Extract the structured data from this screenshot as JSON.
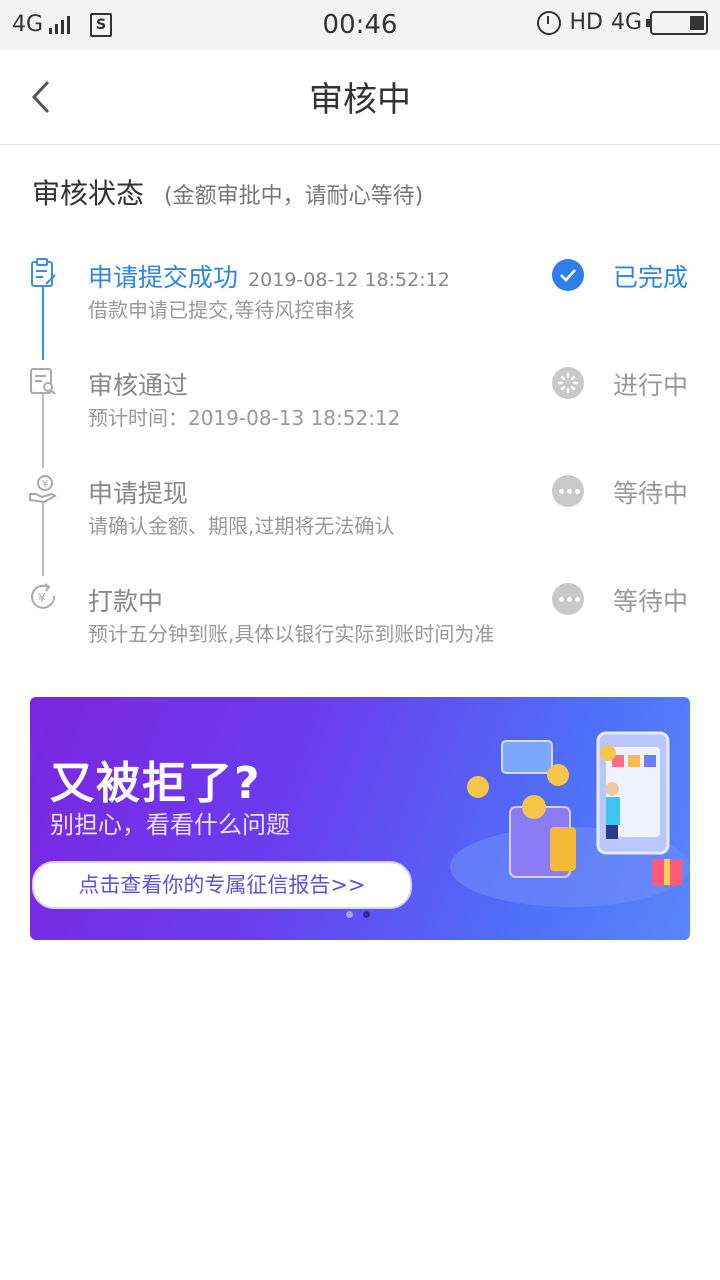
{
  "status_bar": {
    "network": "4G",
    "time": "00:46",
    "hd": "HD",
    "network_right": "4G"
  },
  "nav": {
    "title": "审核中"
  },
  "review": {
    "title": "审核状态",
    "subtitle": "(金额审批中，请耐心等待)",
    "steps": [
      {
        "title": "申请提交成功",
        "time": "2019-08-12 18:52:12",
        "desc": "借款申请已提交,等待风控审核",
        "state": "已完成",
        "status": "done",
        "icon": "clipboard-edit-icon"
      },
      {
        "title": "审核通过",
        "desc": "预计时间：2019-08-13 18:52:12",
        "state": "进行中",
        "status": "in-progress",
        "icon": "document-search-icon"
      },
      {
        "title": "申请提现",
        "desc": "请确认金额、期限,过期将无法确认",
        "state": "等待中",
        "status": "waiting",
        "icon": "hand-coin-icon"
      },
      {
        "title": "打款中",
        "desc": "预计五分钟到账,具体以银行实际到账时间为准",
        "state": "等待中",
        "status": "waiting",
        "icon": "yuan-transfer-icon"
      }
    ]
  },
  "banner": {
    "title": "又被拒了?",
    "subtitle": "别担心，看看什么问题",
    "button": "点击查看你的专属征信报告>>",
    "page_count": 2,
    "active_page": 2
  },
  "colors": {
    "accent": "#2a86e8",
    "inactive": "#c9c9c9",
    "banner_start": "#7b26e0",
    "banner_end": "#5a86fb"
  }
}
